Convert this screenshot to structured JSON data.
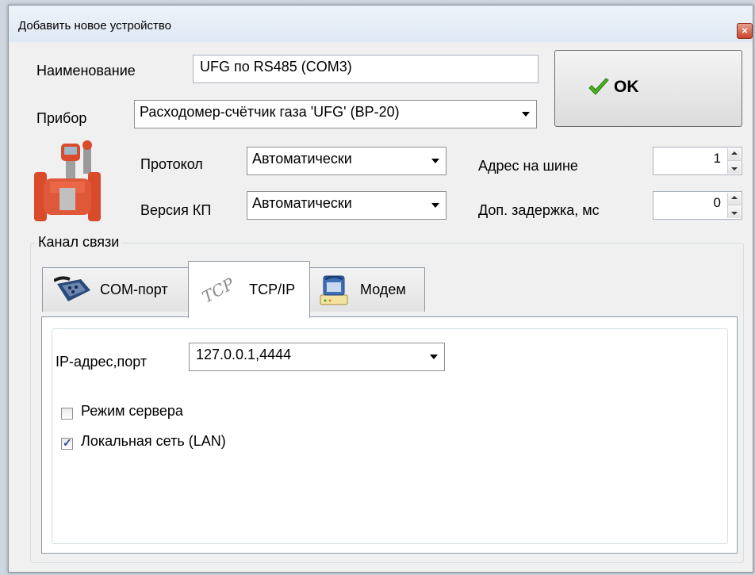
{
  "window": {
    "title": "Добавить новое устройство",
    "close_glyph": "×"
  },
  "form": {
    "name_label": "Наименование",
    "name_value": "UFG по RS485 (COM3)",
    "device_label": "Прибор",
    "device_value": "Расходомер-счётчик газа 'UFG' (ВР-20)",
    "protocol_label": "Протокол",
    "protocol_value": "Автоматически",
    "version_label": "Версия КП",
    "version_value": "Автоматически",
    "address_label": "Адрес на шине",
    "address_value": "1",
    "delay_label": "Доп. задержка, мс",
    "delay_value": "0"
  },
  "ok_button": {
    "label": "OK"
  },
  "channel": {
    "title": "Канал связи",
    "tabs": [
      {
        "label": "COM-порт",
        "icon": "serial-port-icon",
        "active": false
      },
      {
        "label": "TCP/IP",
        "icon": "tcp-icon",
        "icon_text": "TCP",
        "active": true
      },
      {
        "label": "Модем",
        "icon": "modem-phone-icon",
        "active": false
      }
    ],
    "tcp": {
      "ip_label": "IP-адрес,порт",
      "ip_value": "127.0.0.1,4444",
      "server_mode_label": "Режим сервера",
      "server_mode_checked": false,
      "lan_label": "Локальная сеть (LAN)",
      "lan_checked": true
    }
  },
  "colors": {
    "device_red": "#d94b2b",
    "ok_check_green": "#4caf1f",
    "window_bg": "#f0f0f0"
  }
}
